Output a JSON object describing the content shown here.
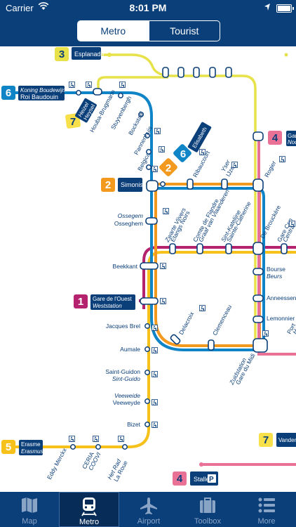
{
  "status_bar": {
    "carrier": "Carrier",
    "time": "8:01 PM"
  },
  "segment": {
    "metro": "Metro",
    "tourist": "Tourist"
  },
  "map": {
    "line_badges": [
      "1",
      "2",
      "3",
      "4",
      "5",
      "6",
      "7"
    ],
    "station_labels": {
      "esplanade": "Esplanade",
      "koning1": "Koning Boudewijn",
      "koning2": "Roi Baudouin",
      "heizel": "Heizel",
      "heysel": "Heysel",
      "houba": "Houba-Brugmann",
      "stuyvenbergh": "Stuyvenbergh",
      "bockstael": "Bockstael",
      "pannenhuis": "Pannenhuis",
      "belgica": "Belgica",
      "elisabeth": "Elisabeth",
      "simonis": "Simonis",
      "ribaucourt": "Ribaucourt",
      "yser": "Yser",
      "ijzer": "IJzer",
      "rogier": "Rogier",
      "gare_nord1": "Gar",
      "gare_nord2": "Noo",
      "ossegem1": "Ossegem",
      "ossegem2": "Osseghem",
      "zwarte1": "Zwarte Vijvers",
      "zwarte2": "Étangs Noirs",
      "comte1": "Comte de Flandre",
      "comte2": "Graaf van Vlaanderen",
      "sint1": "Sint-Katelijne",
      "sint2": "Sainte-Catherine",
      "brouckere": "De Brouckère",
      "gare_centrale1": "Gare Cen",
      "gare_centrale2": "Centra",
      "beekkant": "Beekkant",
      "bourse": "Bourse",
      "beurs": "Beurs",
      "gare_ouest1": "Gare de l'Ouest",
      "gare_ouest2": "Weststation",
      "anneessens": "Anneessens",
      "jacques_brel": "Jacques Brel",
      "delacroix": "Delacroix",
      "clemenceau": "Clemenceau",
      "lemonnier": "Lemonnier",
      "porte1": "Port",
      "porte2": "Ha",
      "aumale": "Aumale",
      "zuid1": "Zuidstation",
      "zuid2": "Gare du Midi",
      "saint_guidon1": "Saint-Guidon",
      "saint_guidon2": "Sint-Guido",
      "veeweide1": "Veeweide",
      "veeweide2": "Veeweyde",
      "bizet": "Bizet",
      "erasme1": "Erasme",
      "erasme2": "Erasmus",
      "eddy": "Eddy Merckx",
      "ceria1": "CERIA",
      "ceria2": "COOVI",
      "hetrad1": "Het Rad",
      "hetrad2": "La Roue",
      "vander": "Vander",
      "stalle": "Stalle",
      "parking": "P"
    }
  },
  "tabs": [
    "Map",
    "Metro",
    "Airport",
    "Toolbox",
    "More"
  ],
  "colors": {
    "bar": "#0b3f7a",
    "line1": "#b5236f",
    "line2": "#f39a1e",
    "line5": "#f7c11c",
    "line6": "#0f84c6",
    "line2_6": "#e7e24a",
    "line4": "#e97196",
    "label_box": "#0b3f7a"
  }
}
